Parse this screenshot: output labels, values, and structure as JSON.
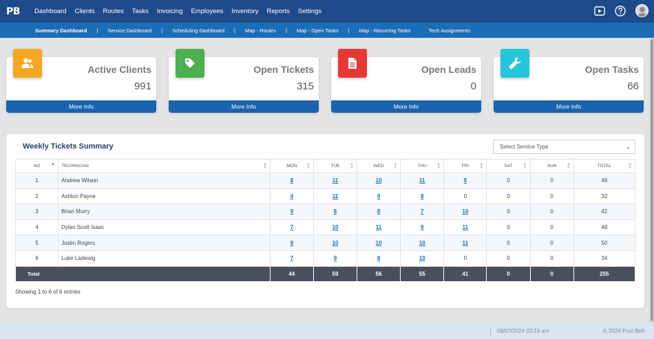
{
  "nav": {
    "logo": "PB",
    "items": [
      "Dashboard",
      "Clients",
      "Routes",
      "Tasks",
      "Invoicing",
      "Employees",
      "Inventory",
      "Reports",
      "Settings"
    ],
    "icons": [
      "video-icon",
      "help-icon",
      "user-avatar"
    ]
  },
  "subnav": {
    "items": [
      "Summary Dashboard",
      "Service Dashboard",
      "Scheduling Dashboard",
      "Map - Routes",
      "Map - Open Tasks",
      "Map - Recurring Tasks",
      "Tech Assignments"
    ],
    "separator": "|"
  },
  "cards": [
    {
      "title": "Active Clients",
      "value": "991",
      "more": "More Info",
      "color": "#f5a623",
      "icon": "users-icon"
    },
    {
      "title": "Open Tickets",
      "value": "315",
      "more": "More Info",
      "color": "#4caf50",
      "icon": "tag-icon"
    },
    {
      "title": "Open Leads",
      "value": "0",
      "more": "More Info",
      "color": "#e53935",
      "icon": "document-icon"
    },
    {
      "title": "Open Tasks",
      "value": "66",
      "more": "More Info",
      "color": "#26c6da",
      "icon": "wrench-icon"
    }
  ],
  "summary": {
    "title": "Weekly Tickets Summary",
    "select_placeholder": "Select Service Type",
    "columns": [
      "NO",
      "TECHNICIAN",
      "MON",
      "TUE",
      "WED",
      "THU",
      "FRI",
      "SAT",
      "SUN",
      "TOTAL"
    ],
    "rows": [
      [
        "1",
        "Andrew Wilson",
        "8",
        "11",
        "10",
        "11",
        "9",
        "0",
        "0",
        "49"
      ],
      [
        "2",
        "Ashton Payne",
        "4",
        "11",
        "9",
        "8",
        "0",
        "0",
        "0",
        "32"
      ],
      [
        "3",
        "Brian Murry",
        "9",
        "8",
        "8",
        "7",
        "10",
        "0",
        "0",
        "42"
      ],
      [
        "4",
        "Dylan Scott Isaac",
        "7",
        "10",
        "11",
        "9",
        "11",
        "0",
        "0",
        "48"
      ],
      [
        "5",
        "Justin Rogers",
        "9",
        "10",
        "10",
        "10",
        "11",
        "0",
        "0",
        "50"
      ],
      [
        "6",
        "Luke Ladewig",
        "7",
        "9",
        "8",
        "10",
        "0",
        "0",
        "0",
        "34"
      ]
    ],
    "total_label": "Total",
    "totals": [
      "44",
      "59",
      "56",
      "55",
      "41",
      "0",
      "0",
      "255"
    ],
    "showing": "Showing 1 to 6 of 6 entries"
  },
  "footer": {
    "datetime": "06/07/2024 03:19 am",
    "copyright": "© 2024 Pool Belt"
  }
}
